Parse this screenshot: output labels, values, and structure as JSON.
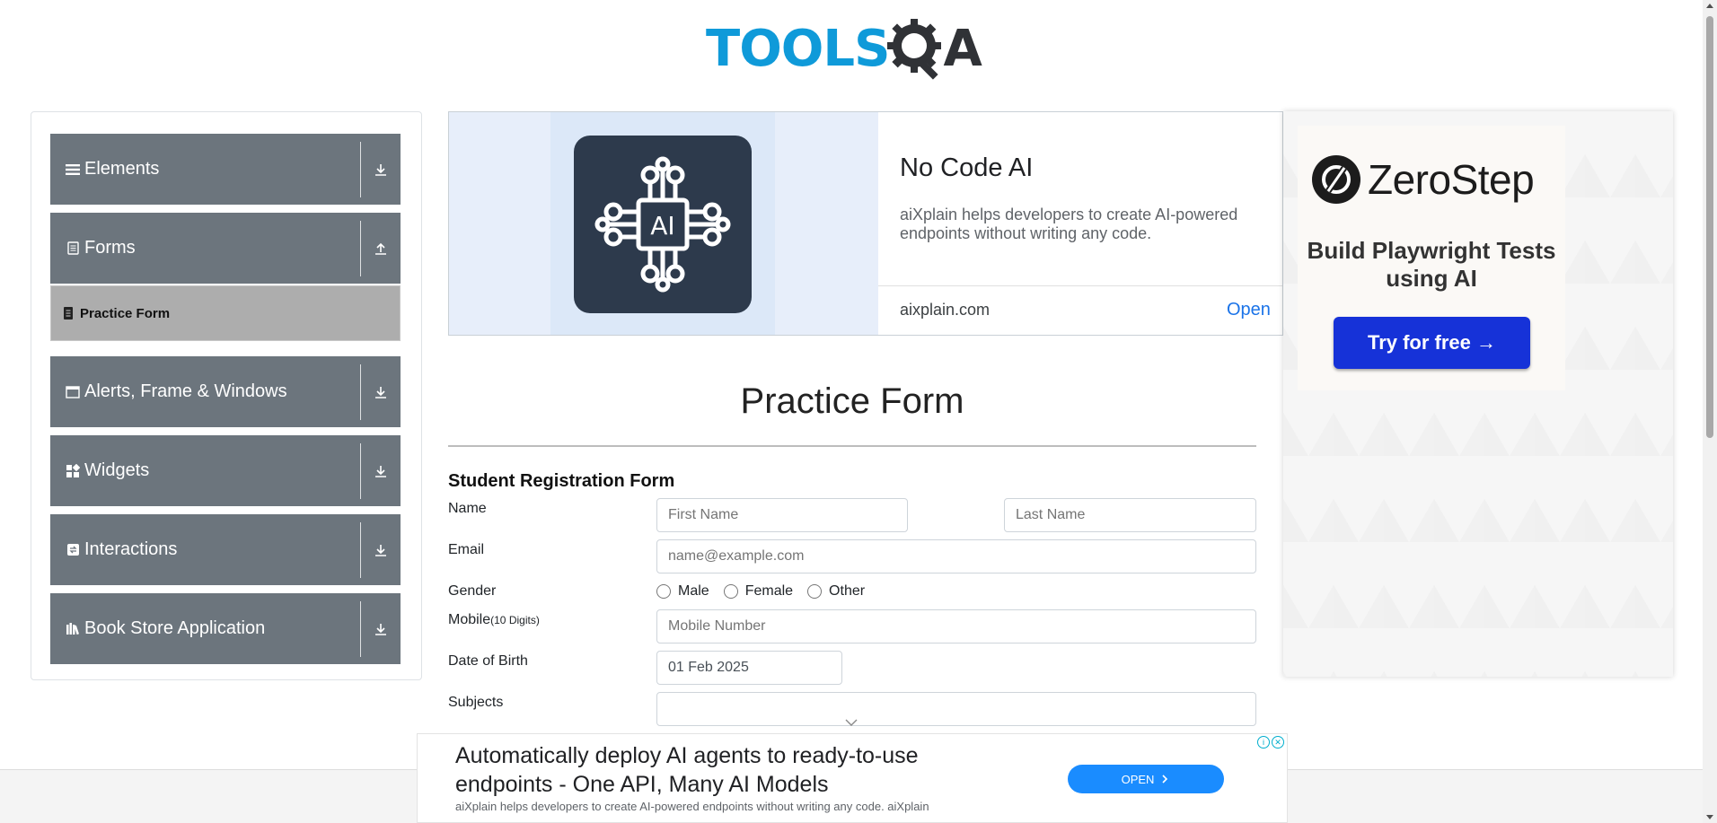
{
  "header": {
    "logo_text": "TOOLS",
    "logo_suffix": "A",
    "logo_icon": "gear-magnifier-icon",
    "colors": {
      "tools": "#0f9ad9",
      "qa": "#303236"
    }
  },
  "sidebar": {
    "groups": [
      {
        "label": "Elements",
        "icon": "menu-icon",
        "arrow": "download-arrow-icon"
      },
      {
        "label": "Forms",
        "icon": "document-icon",
        "arrow": "upload-arrow-icon",
        "expanded": true,
        "items": [
          {
            "label": "Practice Form",
            "icon": "form-icon",
            "active": true
          }
        ]
      },
      {
        "label": "Alerts, Frame & Windows",
        "icon": "window-icon",
        "arrow": "download-arrow-icon"
      },
      {
        "label": "Widgets",
        "icon": "widgets-icon",
        "arrow": "download-arrow-icon"
      },
      {
        "label": "Interactions",
        "icon": "interactions-icon",
        "arrow": "download-arrow-icon"
      },
      {
        "label": "Book Store Application",
        "icon": "books-icon",
        "arrow": "download-arrow-icon"
      }
    ],
    "colors": {
      "group_bg": "#6c757d",
      "active_item_bg": "#adadad"
    }
  },
  "top_ad": {
    "title": "No Code AI",
    "description": "aiXplain helps developers to create AI-powered endpoints without writing any code.",
    "domain": "aixplain.com",
    "cta": "Open",
    "image_icon": "ai-chip-icon",
    "image_icon_text": "AI"
  },
  "right_ad": {
    "brand": "ZeroStep",
    "tagline": "Build Playwright Tests using AI",
    "cta": "Try for free →",
    "brand_icon": "zerostep-logo-icon",
    "colors": {
      "button": "#1632d8"
    }
  },
  "form": {
    "title": "Practice Form",
    "subtitle": "Student Registration Form",
    "fields": {
      "name_label": "Name",
      "first_name_placeholder": "First Name",
      "last_name_placeholder": "Last Name",
      "email_label": "Email",
      "email_placeholder": "name@example.com",
      "gender_label": "Gender",
      "gender_options": [
        "Male",
        "Female",
        "Other"
      ],
      "mobile_label": "Mobile",
      "mobile_hint": "(10 Digits)",
      "mobile_placeholder": "Mobile Number",
      "dob_label": "Date of Birth",
      "dob_value": "01 Feb 2025",
      "subjects_label": "Subjects",
      "subjects_value": ""
    }
  },
  "bottom_ad": {
    "title": "Automatically deploy AI agents to ready-to-use endpoints - One API, Many AI Models",
    "description": "aiXplain helps developers to create AI-powered endpoints without writing any code. aiXplain",
    "cta": "OPEN",
    "icons": [
      "ad-info-icon",
      "ad-close-icon"
    ]
  }
}
